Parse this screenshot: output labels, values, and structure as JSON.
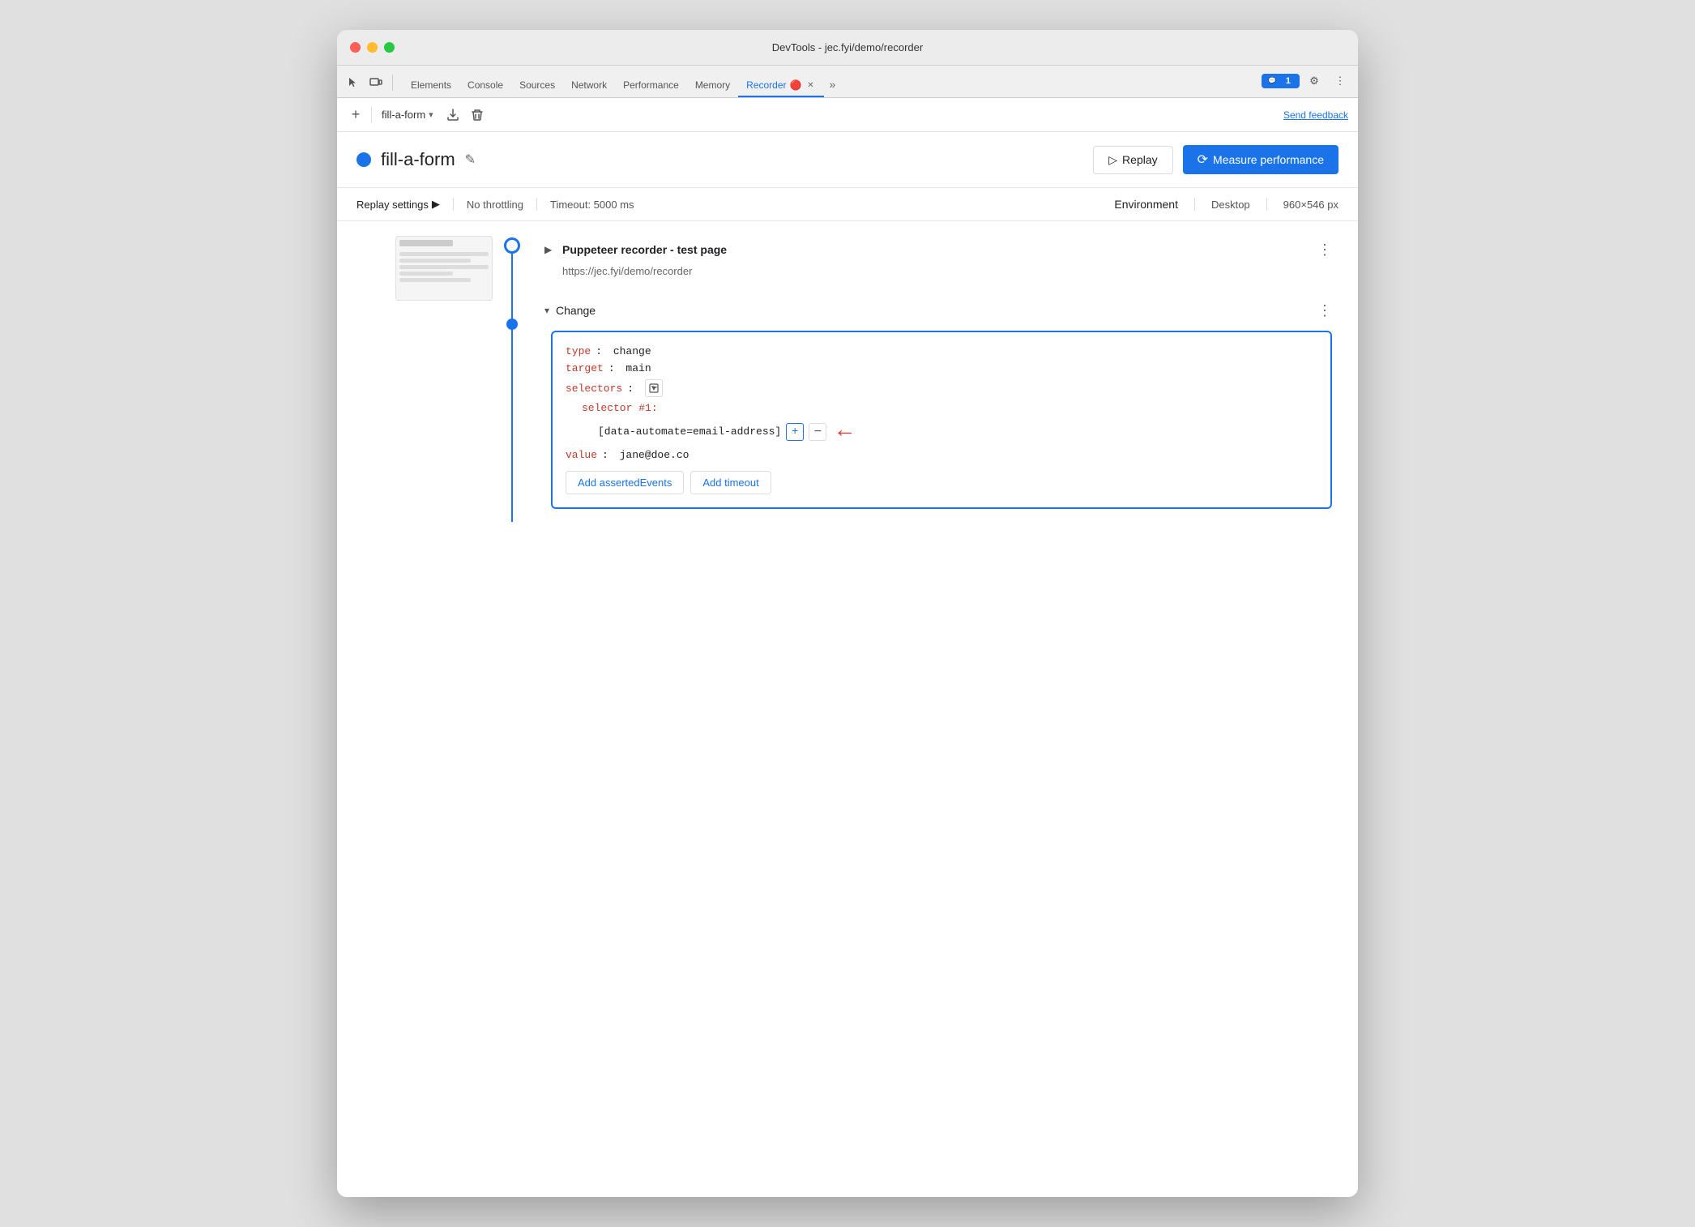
{
  "window": {
    "title": "DevTools - jec.fyi/demo/recorder"
  },
  "tabs": [
    {
      "id": "elements",
      "label": "Elements",
      "active": false
    },
    {
      "id": "console",
      "label": "Console",
      "active": false
    },
    {
      "id": "sources",
      "label": "Sources",
      "active": false
    },
    {
      "id": "network",
      "label": "Network",
      "active": false
    },
    {
      "id": "performance",
      "label": "Performance",
      "active": false
    },
    {
      "id": "memory",
      "label": "Memory",
      "active": false
    },
    {
      "id": "recorder",
      "label": "Recorder",
      "active": true
    },
    {
      "id": "more",
      "label": "»",
      "active": false
    }
  ],
  "toolbar": {
    "add_label": "+",
    "recording_name": "fill-a-form",
    "send_feedback": "Send feedback"
  },
  "recording": {
    "name": "fill-a-form",
    "replay_label": "Replay",
    "measure_label": "Measure performance"
  },
  "replay_settings": {
    "label": "Replay settings",
    "throttling": "No throttling",
    "timeout_label": "Timeout: 5000 ms",
    "environment_label": "Environment",
    "device": "Desktop",
    "resolution": "960×546 px"
  },
  "steps": [
    {
      "id": "step1",
      "title": "Puppeteer recorder - test page",
      "url": "https://jec.fyi/demo/recorder",
      "expanded": false
    },
    {
      "id": "step2",
      "title": "Change",
      "expanded": true,
      "code": {
        "type_key": "type",
        "type_value": "change",
        "target_key": "target",
        "target_value": "main",
        "selectors_key": "selectors",
        "selector1_label": "selector #1:",
        "selector1_value": "[data-automate=email-address]",
        "value_key": "value",
        "value_val": "jane@doe.co"
      },
      "actions": [
        {
          "id": "add-asserted",
          "label": "Add assertedEvents"
        },
        {
          "id": "add-timeout",
          "label": "Add timeout"
        }
      ]
    }
  ],
  "chat_badge": "1",
  "icons": {
    "cursor": "⬚",
    "expand_more": "▶",
    "download": "⬇",
    "trash": "🗑",
    "more_vert": "⋮",
    "edit": "✎",
    "play": "▷",
    "measure_icon": "⟳",
    "chevron_right": "▶",
    "chevron_down": "▾",
    "inspect": "⬚",
    "gear": "⚙",
    "dots_three": "⋮",
    "close": "✕",
    "chat": "💬"
  }
}
